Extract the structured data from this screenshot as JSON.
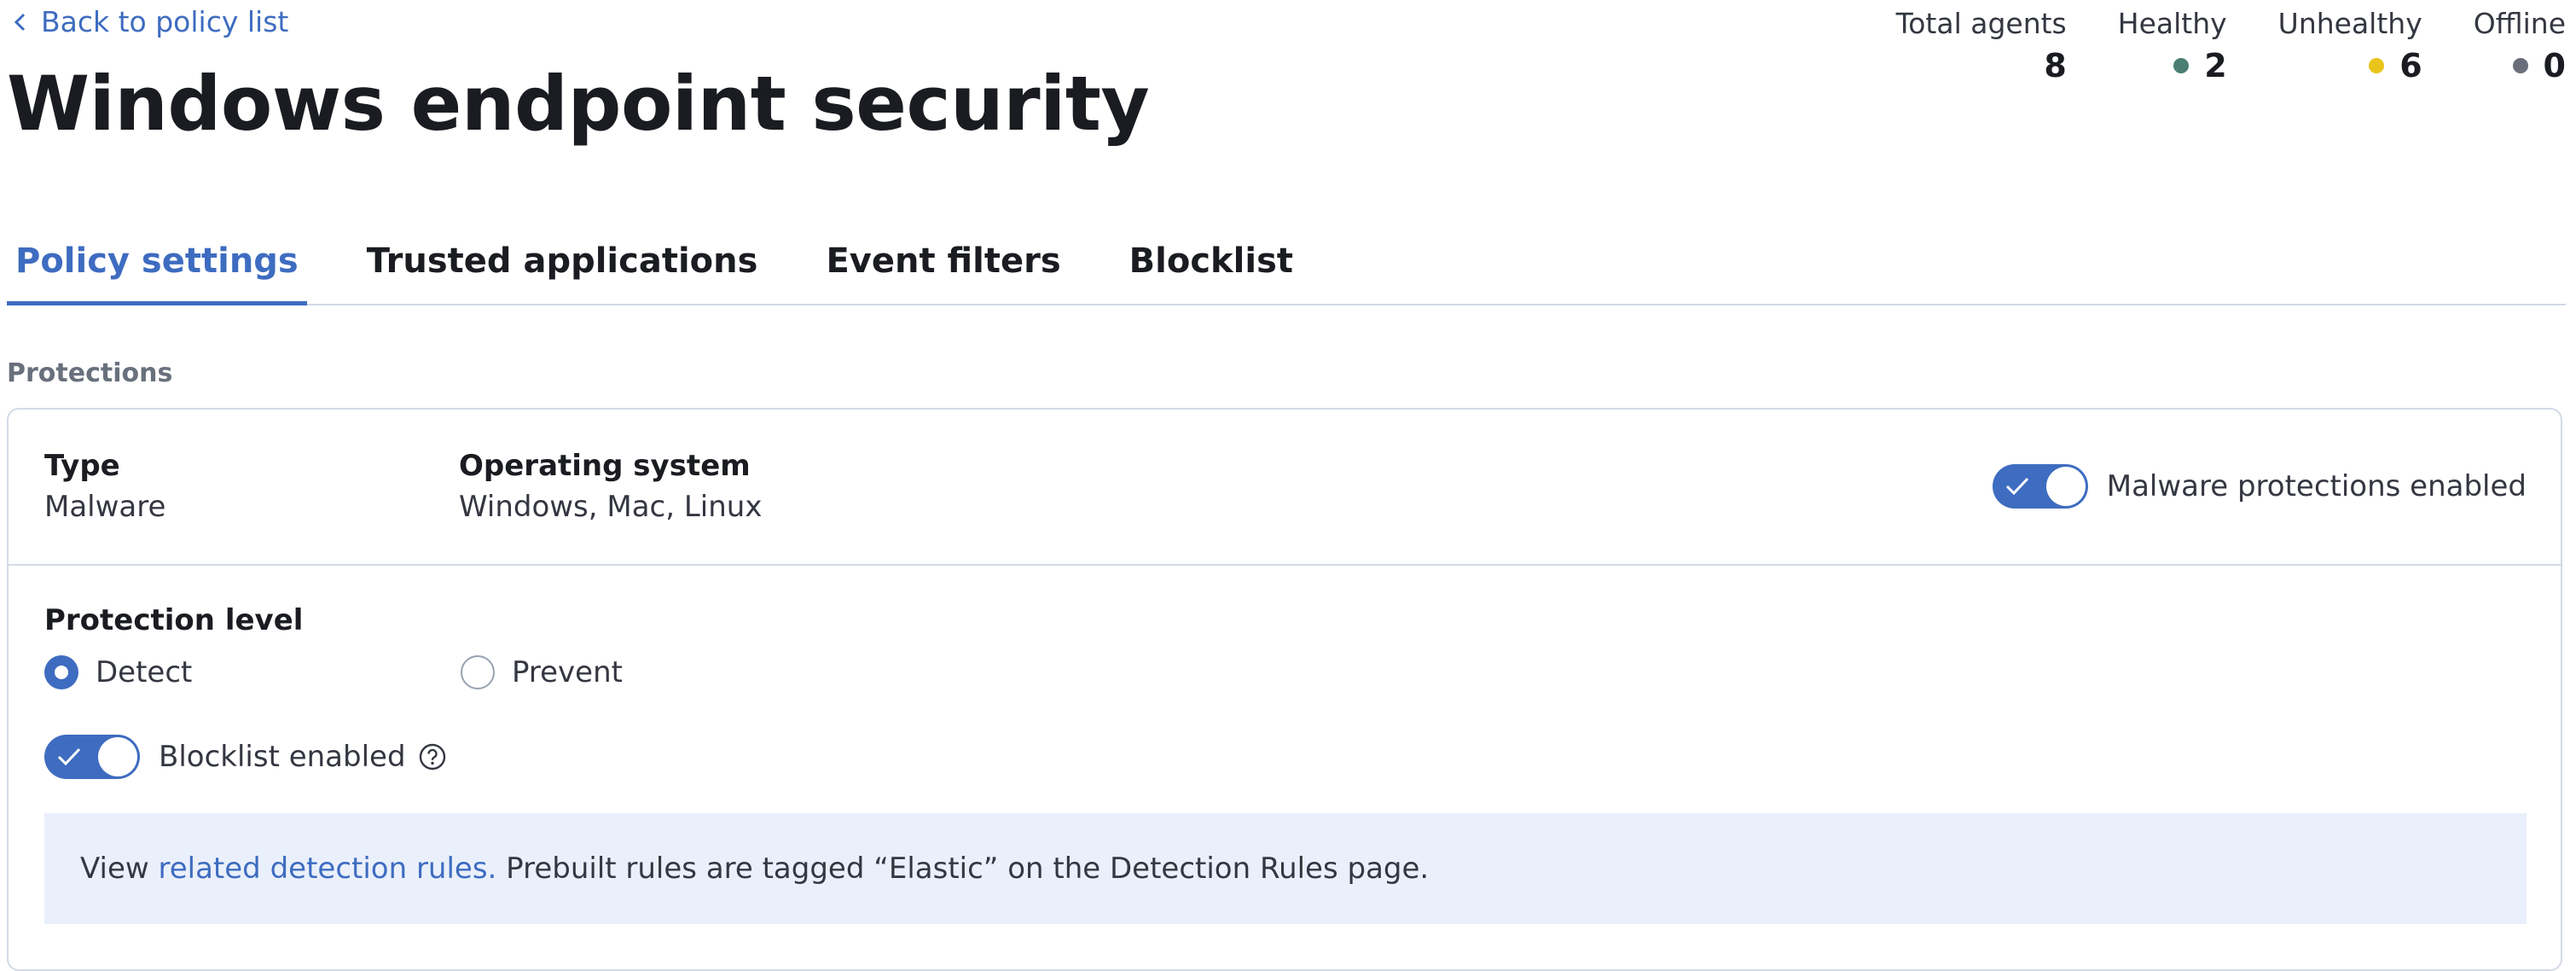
{
  "header": {
    "back_link": "Back to policy list",
    "title": "Windows endpoint security"
  },
  "stats": [
    {
      "label": "Total agents",
      "value": "8"
    },
    {
      "label": "Healthy",
      "value": "2",
      "dot_color": "#4c7f74"
    },
    {
      "label": "Unhealthy",
      "value": "6",
      "dot_color": "#e9c51b"
    },
    {
      "label": "Offline",
      "value": "0",
      "dot_color": "#6a6e7b"
    }
  ],
  "tabs": [
    {
      "label": "Policy settings",
      "active": true
    },
    {
      "label": "Trusted applications",
      "active": false
    },
    {
      "label": "Event filters",
      "active": false
    },
    {
      "label": "Blocklist",
      "active": false
    }
  ],
  "section_label": "Protections",
  "protection_card": {
    "type_title": "Type",
    "type_value": "Malware",
    "os_title": "Operating system",
    "os_value": "Windows, Mac, Linux",
    "enabled_switch_label": "Malware protections enabled",
    "enabled": true,
    "protection_level_title": "Protection level",
    "options": [
      {
        "label": "Detect",
        "selected": true
      },
      {
        "label": "Prevent",
        "selected": false
      }
    ],
    "blocklist_switch_label": "Blocklist enabled",
    "blocklist_enabled": true,
    "callout": {
      "prefix": "View ",
      "link_text": "related detection rules.",
      "suffix": " Prebuilt rules are tagged “Elastic” on the Detection Rules page."
    }
  },
  "colors": {
    "accent": "#3e6cc0",
    "callout_bg": "#eaf0fb",
    "border": "#d3dae6"
  }
}
